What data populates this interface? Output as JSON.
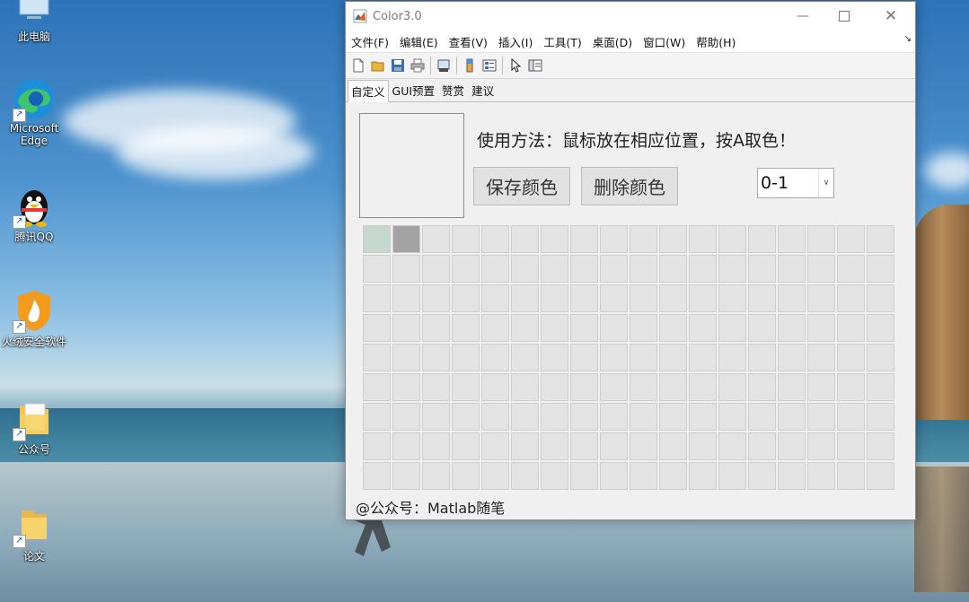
{
  "desktop": {
    "icons": [
      {
        "label": "此电脑",
        "icon": "this-pc-icon"
      },
      {
        "label": "Microsoft Edge",
        "icon": "edge-icon"
      },
      {
        "label": "腾讯QQ",
        "icon": "qq-penguin-icon"
      },
      {
        "label": "火绒安全软件",
        "icon": "huorong-shield-icon"
      },
      {
        "label": "公众号",
        "icon": "file-folder-icon"
      },
      {
        "label": "论文",
        "icon": "folder-icon"
      }
    ]
  },
  "window": {
    "title": "Color3.0",
    "menu": [
      "文件(F)",
      "编辑(E)",
      "查看(V)",
      "插入(I)",
      "工具(T)",
      "桌面(D)",
      "窗口(W)",
      "帮助(H)"
    ],
    "toolbar": [
      "new-file-icon",
      "open-folder-icon",
      "save-icon",
      "print-icon",
      "print-preview-icon",
      "colorbar-icon",
      "legend-icon",
      "pointer-icon",
      "property-editor-icon"
    ],
    "tabs": [
      "自定义",
      "GUI预置",
      "赞赏",
      "建议"
    ],
    "active_tab": 0,
    "instruction": "使用方法：鼠标放在相应位置，按A取色！",
    "save_button": "保存颜色",
    "delete_button": "删除颜色",
    "range_select": "0-1",
    "footer": "@公众号：Matlab随笔",
    "swatches": {
      "rows": 9,
      "cols": 18,
      "default_color": "#e3e3e3",
      "filled": [
        "#c7d9cf",
        "#a3a3a3"
      ]
    }
  }
}
